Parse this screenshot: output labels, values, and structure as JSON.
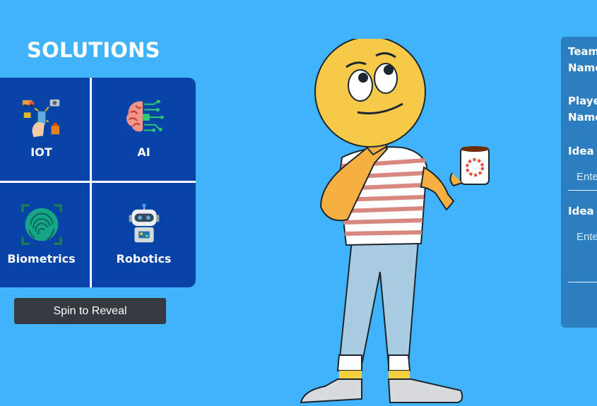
{
  "solutions": {
    "title": "SOLUTIONS",
    "tiles": [
      {
        "label": "IOT",
        "icon": "iot-icon"
      },
      {
        "label": "AI",
        "icon": "ai-brain-icon"
      },
      {
        "label": "Biometrics",
        "icon": "fingerprint-icon"
      },
      {
        "label": "Robotics",
        "icon": "robot-icon"
      }
    ],
    "spin_label": "Spin to Reveal"
  },
  "character": {
    "icon": "thinking-emoji-character"
  },
  "form": {
    "team_label_1": "Team",
    "team_label_2": "Name",
    "player_label_1": "Playe",
    "player_label_2": "Name",
    "idea_name_label": "Idea N",
    "idea_name_placeholder": "Ente",
    "idea_desc_label": "Idea D",
    "idea_desc_placeholder": "Ente"
  },
  "colors": {
    "background": "#40b3fb",
    "tile": "#0844a8",
    "button": "#343a40",
    "panel": "#2b7fc0"
  }
}
